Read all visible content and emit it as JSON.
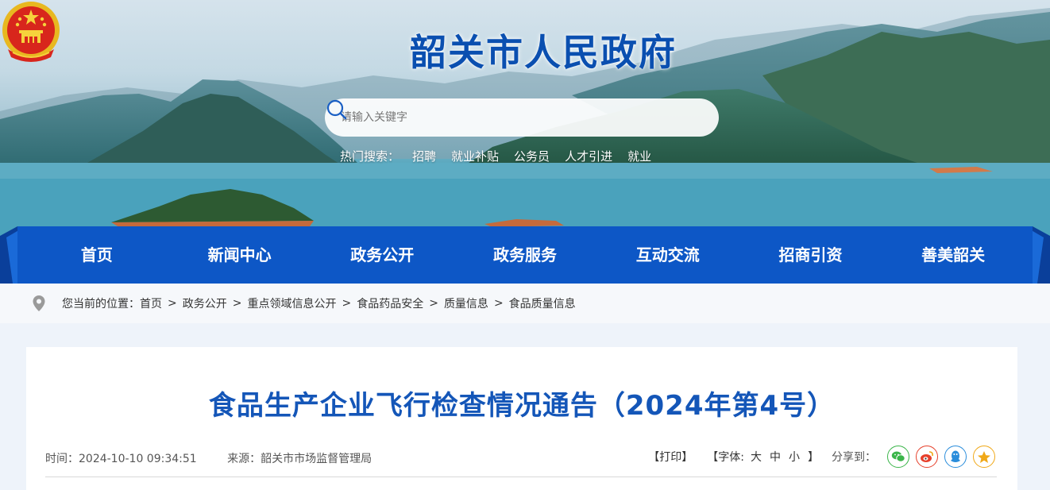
{
  "header": {
    "site_title": "韶关市人民政府",
    "emblem_icon": "national-emblem-icon",
    "search": {
      "placeholder": "请输入关键字",
      "button_icon": "search-icon"
    },
    "hot_search": {
      "label": "热门搜索：",
      "items": [
        "招聘",
        "就业补贴",
        "公务员",
        "人才引进",
        "就业"
      ]
    }
  },
  "nav": {
    "items": [
      "首页",
      "新闻中心",
      "政务公开",
      "政务服务",
      "互动交流",
      "招商引资",
      "善美韶关"
    ]
  },
  "breadcrumb": {
    "prefix": "您当前的位置：",
    "items": [
      "首页",
      "政务公开",
      "重点领域信息公开",
      "食品药品安全",
      "质量信息",
      "食品质量信息"
    ],
    "separator": ">",
    "icon": "location-pin-icon"
  },
  "article": {
    "title": "食品生产企业飞行检查情况通告（2024年第4号）",
    "time_label": "时间：",
    "time": "2024-10-10 09:34:51",
    "source_label": "来源：",
    "source": "韶关市市场监督管理局",
    "print_label": "【打印】",
    "font_label": "【字体:",
    "font_sizes": [
      "大",
      "中",
      "小"
    ],
    "font_close": "】",
    "share_label": "分享到：",
    "share_icons": [
      {
        "name": "wechat-icon",
        "color": "#3bb54a"
      },
      {
        "name": "weibo-icon",
        "color": "#e6402b"
      },
      {
        "name": "qq-icon",
        "color": "#2a8ddb"
      },
      {
        "name": "qzone-icon",
        "color": "#f0a818"
      }
    ]
  },
  "colors": {
    "brand_blue": "#0a4fb0",
    "nav_blue": "#0d57c6",
    "title_blue": "#1456b8"
  }
}
